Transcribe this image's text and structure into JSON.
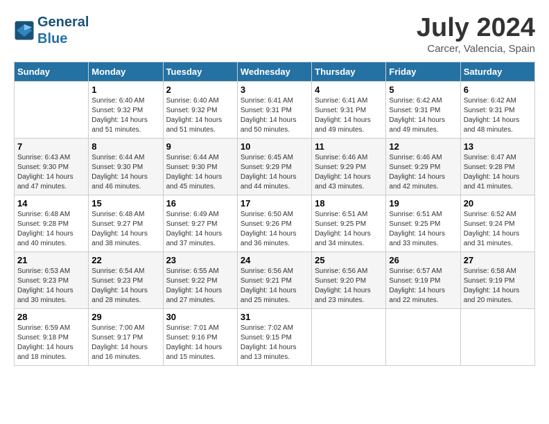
{
  "header": {
    "logo_line1": "General",
    "logo_line2": "Blue",
    "title": "July 2024",
    "location": "Carcer, Valencia, Spain"
  },
  "days_of_week": [
    "Sunday",
    "Monday",
    "Tuesday",
    "Wednesday",
    "Thursday",
    "Friday",
    "Saturday"
  ],
  "weeks": [
    [
      {
        "day": "",
        "info": ""
      },
      {
        "day": "1",
        "info": "Sunrise: 6:40 AM\nSunset: 9:32 PM\nDaylight: 14 hours\nand 51 minutes."
      },
      {
        "day": "2",
        "info": "Sunrise: 6:40 AM\nSunset: 9:32 PM\nDaylight: 14 hours\nand 51 minutes."
      },
      {
        "day": "3",
        "info": "Sunrise: 6:41 AM\nSunset: 9:31 PM\nDaylight: 14 hours\nand 50 minutes."
      },
      {
        "day": "4",
        "info": "Sunrise: 6:41 AM\nSunset: 9:31 PM\nDaylight: 14 hours\nand 49 minutes."
      },
      {
        "day": "5",
        "info": "Sunrise: 6:42 AM\nSunset: 9:31 PM\nDaylight: 14 hours\nand 49 minutes."
      },
      {
        "day": "6",
        "info": "Sunrise: 6:42 AM\nSunset: 9:31 PM\nDaylight: 14 hours\nand 48 minutes."
      }
    ],
    [
      {
        "day": "7",
        "info": "Sunrise: 6:43 AM\nSunset: 9:30 PM\nDaylight: 14 hours\nand 47 minutes."
      },
      {
        "day": "8",
        "info": "Sunrise: 6:44 AM\nSunset: 9:30 PM\nDaylight: 14 hours\nand 46 minutes."
      },
      {
        "day": "9",
        "info": "Sunrise: 6:44 AM\nSunset: 9:30 PM\nDaylight: 14 hours\nand 45 minutes."
      },
      {
        "day": "10",
        "info": "Sunrise: 6:45 AM\nSunset: 9:29 PM\nDaylight: 14 hours\nand 44 minutes."
      },
      {
        "day": "11",
        "info": "Sunrise: 6:46 AM\nSunset: 9:29 PM\nDaylight: 14 hours\nand 43 minutes."
      },
      {
        "day": "12",
        "info": "Sunrise: 6:46 AM\nSunset: 9:29 PM\nDaylight: 14 hours\nand 42 minutes."
      },
      {
        "day": "13",
        "info": "Sunrise: 6:47 AM\nSunset: 9:28 PM\nDaylight: 14 hours\nand 41 minutes."
      }
    ],
    [
      {
        "day": "14",
        "info": "Sunrise: 6:48 AM\nSunset: 9:28 PM\nDaylight: 14 hours\nand 40 minutes."
      },
      {
        "day": "15",
        "info": "Sunrise: 6:48 AM\nSunset: 9:27 PM\nDaylight: 14 hours\nand 38 minutes."
      },
      {
        "day": "16",
        "info": "Sunrise: 6:49 AM\nSunset: 9:27 PM\nDaylight: 14 hours\nand 37 minutes."
      },
      {
        "day": "17",
        "info": "Sunrise: 6:50 AM\nSunset: 9:26 PM\nDaylight: 14 hours\nand 36 minutes."
      },
      {
        "day": "18",
        "info": "Sunrise: 6:51 AM\nSunset: 9:25 PM\nDaylight: 14 hours\nand 34 minutes."
      },
      {
        "day": "19",
        "info": "Sunrise: 6:51 AM\nSunset: 9:25 PM\nDaylight: 14 hours\nand 33 minutes."
      },
      {
        "day": "20",
        "info": "Sunrise: 6:52 AM\nSunset: 9:24 PM\nDaylight: 14 hours\nand 31 minutes."
      }
    ],
    [
      {
        "day": "21",
        "info": "Sunrise: 6:53 AM\nSunset: 9:23 PM\nDaylight: 14 hours\nand 30 minutes."
      },
      {
        "day": "22",
        "info": "Sunrise: 6:54 AM\nSunset: 9:23 PM\nDaylight: 14 hours\nand 28 minutes."
      },
      {
        "day": "23",
        "info": "Sunrise: 6:55 AM\nSunset: 9:22 PM\nDaylight: 14 hours\nand 27 minutes."
      },
      {
        "day": "24",
        "info": "Sunrise: 6:56 AM\nSunset: 9:21 PM\nDaylight: 14 hours\nand 25 minutes."
      },
      {
        "day": "25",
        "info": "Sunrise: 6:56 AM\nSunset: 9:20 PM\nDaylight: 14 hours\nand 23 minutes."
      },
      {
        "day": "26",
        "info": "Sunrise: 6:57 AM\nSunset: 9:19 PM\nDaylight: 14 hours\nand 22 minutes."
      },
      {
        "day": "27",
        "info": "Sunrise: 6:58 AM\nSunset: 9:19 PM\nDaylight: 14 hours\nand 20 minutes."
      }
    ],
    [
      {
        "day": "28",
        "info": "Sunrise: 6:59 AM\nSunset: 9:18 PM\nDaylight: 14 hours\nand 18 minutes."
      },
      {
        "day": "29",
        "info": "Sunrise: 7:00 AM\nSunset: 9:17 PM\nDaylight: 14 hours\nand 16 minutes."
      },
      {
        "day": "30",
        "info": "Sunrise: 7:01 AM\nSunset: 9:16 PM\nDaylight: 14 hours\nand 15 minutes."
      },
      {
        "day": "31",
        "info": "Sunrise: 7:02 AM\nSunset: 9:15 PM\nDaylight: 14 hours\nand 13 minutes."
      },
      {
        "day": "",
        "info": ""
      },
      {
        "day": "",
        "info": ""
      },
      {
        "day": "",
        "info": ""
      }
    ]
  ]
}
